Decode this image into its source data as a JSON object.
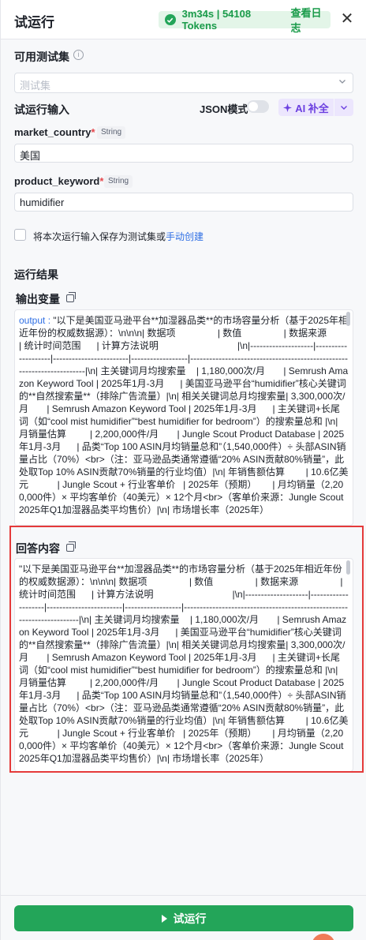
{
  "header": {
    "title": "试运行",
    "run_stats": "3m34s | 54108 Tokens",
    "view_log": "查看日志",
    "close": "✕"
  },
  "test_set": {
    "label": "可用测试集",
    "placeholder": "测试集"
  },
  "run_input": {
    "label": "试运行输入",
    "json_mode_label": "JSON模式",
    "json_mode_on": false,
    "ai_fill_label": "AI 补全",
    "fields": [
      {
        "name": "market_country",
        "type": "String",
        "value": "美国"
      },
      {
        "name": "product_keyword",
        "type": "String",
        "value": "humidifier"
      }
    ],
    "save_text": "将本次运行输入保存为测试集或",
    "save_link": "手动创建"
  },
  "results": {
    "label": "运行结果",
    "output_var_label": "输出变量",
    "output_key": "output",
    "output_text": "\"以下是美国亚马逊平台**加湿器品类**的市场容量分析（基于2025年相近年份的权威数据源）：\\n\\n\\n| 数据项                | 数值                | 数据来源                | 统计时间范围      | 计算方法说明                              |\\n|--------------------|--------------------|------------------------|------------------|-----------------------------------------------------------------------|\\n| 主关键词月均搜索量    | 1,180,000次/月       | Semrush Amazon Keyword Tool | 2025年1月-3月      | 美国亚马逊平台“humidifier”核心关键词的**自然搜索量**（排除广告流量）|\\n| 相关关键词总月均搜索量| 3,300,000次/月       | Semrush Amazon Keyword Tool | 2025年1月-3月      | 主关键词+长尾词（如“cool mist humidifier”“best humidifier for bedroom”）的搜索量总和 |\\n| 月销量估算         | 2,200,000件/月       | Jungle Scout Product Database | 2025年1月-3月      | 品类“Top 100 ASIN月均销量总和”（1,540,000件）÷ 头部ASIN销量占比（70%）<br>（注：亚马逊品类通常遵循“20% ASIN贡献80%销量”，此处取Top 10% ASIN贡献70%销量的行业均值）|\\n| 年销售额估算        | 10.6亿美元           | Jungle Scout + 行业客单价   | 2025年（预期）      | 月均销量（2,200,000件）× 平均客单价（40美元）× 12个月<br>（客单价来源：Jungle Scout 2025年Q1加湿器品类平均售价）|\\n| 市场增长率（2025年）",
    "answer_label": "回答内容",
    "answer_text": "\"以下是美国亚马逊平台**加湿器品类**的市场容量分析（基于2025年相近年份的权威数据源）：\\n\\n\\n| 数据项                | 数值                | 数据来源                | 统计时间范围      | 计算方法说明                              |\\n|--------------------|--------------------|------------------------|------------------|-----------------------------------------------------------------------|\\n| 主关键词月均搜索量    | 1,180,000次/月       | Semrush Amazon Keyword Tool | 2025年1月-3月      | 美国亚马逊平台“humidifier”核心关键词的**自然搜索量**（排除广告流量）|\\n| 相关关键词总月均搜索量| 3,300,000次/月       | Semrush Amazon Keyword Tool | 2025年1月-3月      | 主关键词+长尾词（如“cool mist humidifier”“best humidifier for bedroom”）的搜索量总和 |\\n| 月销量估算         | 2,200,000件/月       | Jungle Scout Product Database | 2025年1月-3月      | 品类“Top 100 ASIN月均销量总和”（1,540,000件）÷ 头部ASIN销量占比（70%）<br>（注：亚马逊品类通常遵循“20% ASIN贡献80%销量”，此处取Top 10% ASIN贡献70%销量的行业均值）|\\n| 年销售额估算        | 10.6亿美元           | Jungle Scout + 行业客单价   | 2025年（预期）      | 月均销量（2,200,000件）× 平均客单价（40美元）× 12个月<br>（客单价来源：Jungle Scout 2025年Q1加湿器品类平均售价）|\\n| 市场增长率（2025年）"
  },
  "footer": {
    "run_button": "试运行"
  },
  "colors": {
    "primary_green": "#23a559",
    "ai_purple": "#6b3fe0",
    "highlight_red": "#e53a3a",
    "link_blue": "#2f6fe4"
  }
}
